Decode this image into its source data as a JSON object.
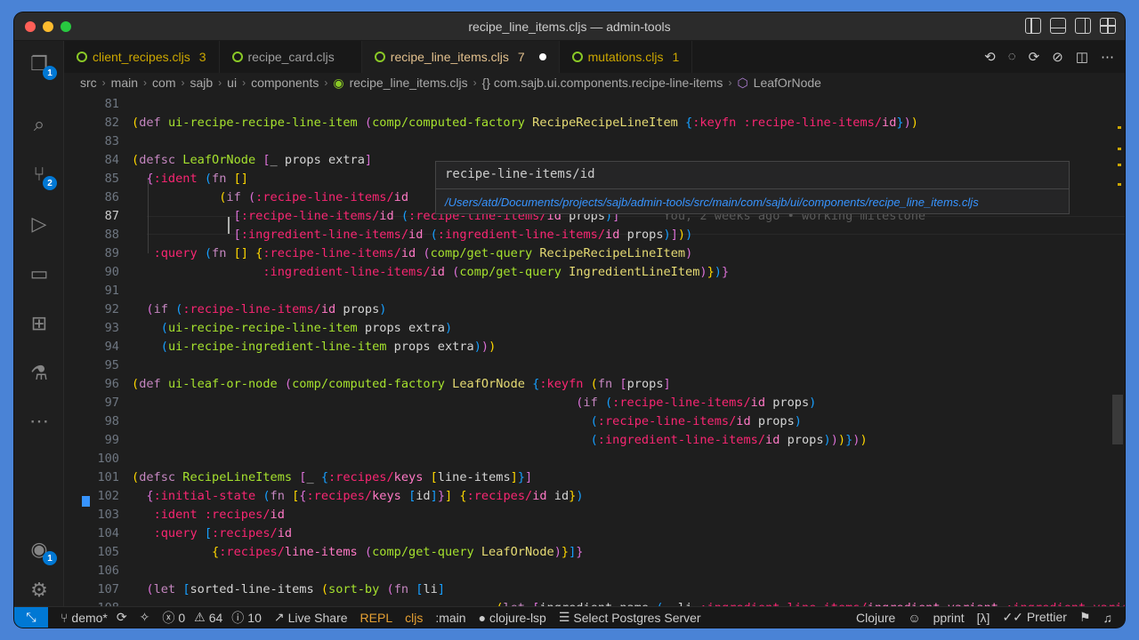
{
  "window": {
    "title": "recipe_line_items.cljs — admin-tools"
  },
  "activity": {
    "explorer_badge": "1",
    "scm_badge": "2",
    "accounts_badge": "1"
  },
  "tabs": [
    {
      "label": "client_recipes.cljs",
      "count": "3"
    },
    {
      "label": "recipe_card.cljs",
      "count": ""
    },
    {
      "label": "recipe_line_items.cljs",
      "count": "7"
    },
    {
      "label": "mutations.cljs",
      "count": "1"
    }
  ],
  "breadcrumb": [
    "src",
    "main",
    "com",
    "sajb",
    "ui",
    "components",
    "recipe_line_items.cljs",
    "{} com.sajb.ui.components.recipe-line-items",
    "LeafOrNode"
  ],
  "hover": {
    "symbol": "recipe-line-items/id",
    "path": "/Users/atd/Documents/projects/sajb/admin-tools/src/main/com/sajb/ui/components/recipe_line_items.cljs"
  },
  "blame": "You, 2 weeks ago • working milestone",
  "line_numbers": [
    "81",
    "82",
    "83",
    "84",
    "85",
    "86",
    "87",
    "88",
    "89",
    "90",
    "91",
    "92",
    "93",
    "94",
    "95",
    "96",
    "97",
    "98",
    "99",
    "100",
    "101",
    "102",
    "103",
    "104",
    "105",
    "106",
    "107",
    "108"
  ],
  "status": {
    "branch": "demo*",
    "errors": "0",
    "warnings": "64",
    "infos": "10",
    "live_share": "Live Share",
    "repl": "REPL",
    "cljs": "cljs",
    "main": ":main",
    "lsp": "clojure-lsp",
    "postgres": "Select Postgres Server",
    "language": "Clojure",
    "pprint": "pprint",
    "lambda": "[λ]",
    "prettier": "Prettier"
  },
  "colors": {
    "accent": "#0078d4",
    "background": "#1e1e1e"
  }
}
